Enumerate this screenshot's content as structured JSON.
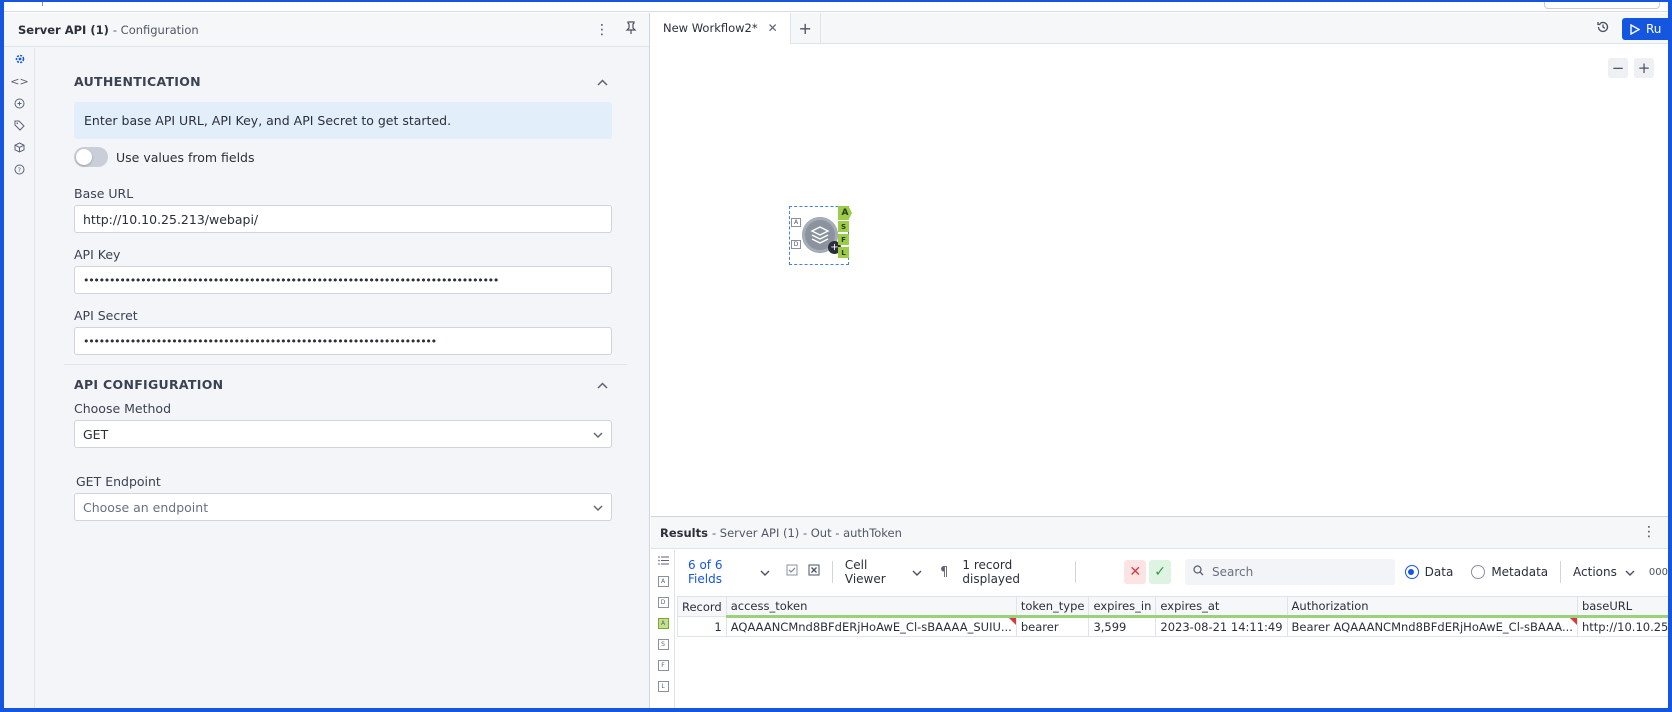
{
  "config_panel": {
    "title": "Server API (1)",
    "subtitle": "- Configuration",
    "authentication": {
      "section_title": "AUTHENTICATION",
      "info_text": "Enter base API URL, API Key, and API Secret to get started.",
      "toggle_label": "Use values from fields",
      "base_url_label": "Base URL",
      "base_url_value": "http://10.10.25.213/webapi/",
      "api_key_label": "API Key",
      "api_key_value": "••••••••••••••••••••••••••••••••••••••••••••••••••••••••••••••••••••••••••••••••",
      "api_secret_label": "API Secret",
      "api_secret_value": "••••••••••••••••••••••••••••••••••••••••••••••••••••••••••••••••••••"
    },
    "api_configuration": {
      "section_title": "API CONFIGURATION",
      "method_label": "Choose Method",
      "method_value": "GET",
      "endpoint_label": "GET Endpoint",
      "endpoint_placeholder": "Choose an endpoint"
    }
  },
  "workflow": {
    "tab_label": "New Workflow2*",
    "run_label": "Ru",
    "tool_anchors_in": [
      "A",
      "D"
    ],
    "tool_anchors_out": [
      "A",
      "S",
      "F",
      "L"
    ]
  },
  "results": {
    "title": "Results",
    "subtitle": "- Server API (1) - Out - authToken",
    "fields_label": "6 of 6 Fields",
    "cell_viewer_label": "Cell Viewer",
    "records_label": "1 record displayed",
    "search_placeholder": "Search",
    "data_label": "Data",
    "metadata_label": "Metadata",
    "actions_label": "Actions",
    "more_label": "000",
    "rail_anchors": [
      "A",
      "D",
      "A",
      "S",
      "F",
      "L"
    ],
    "columns": [
      "Record",
      "access_token",
      "token_type",
      "expires_in",
      "expires_at",
      "Authorization",
      "baseURL"
    ],
    "rows": [
      [
        "1",
        "AQAAANCMnd8BFdERjHoAwE_Cl-sBAAAA_SUIU...",
        "bearer",
        "3,599",
        "2023-08-21 14:11:49",
        "Bearer  AQAAANCMnd8BFdERjHoAwE_Cl-sBAAA...",
        "http://10.10.25"
      ]
    ]
  }
}
